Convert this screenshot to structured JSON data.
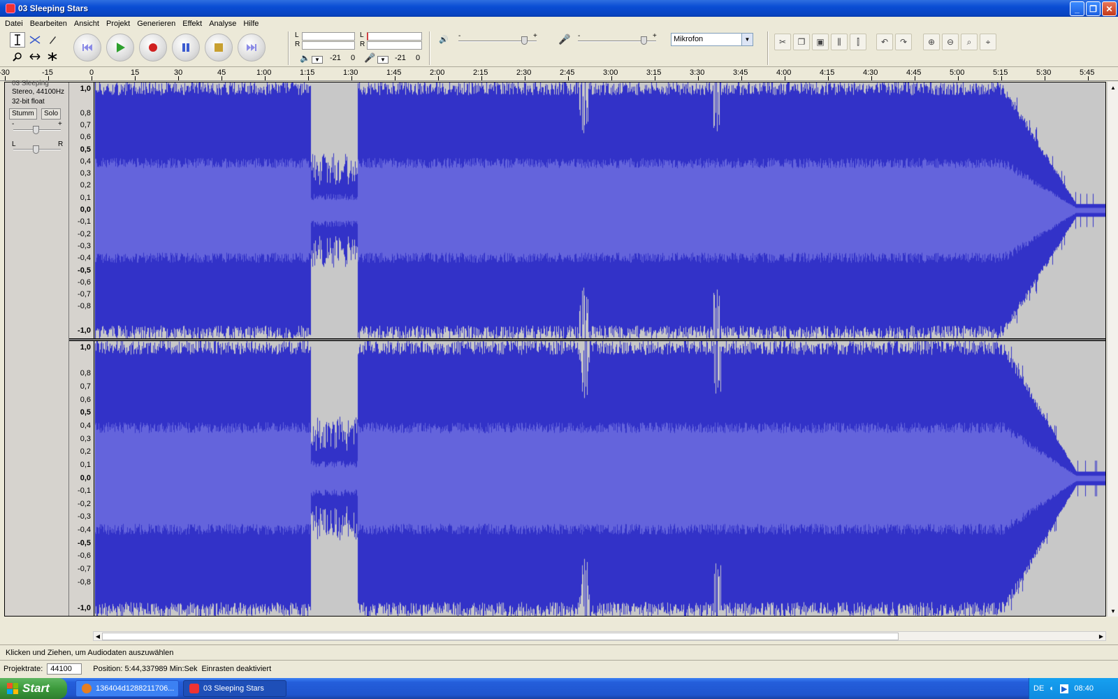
{
  "window": {
    "title": "03 Sleeping Stars",
    "minimize": "_",
    "maximize": "❐",
    "close": "✕"
  },
  "menu": [
    "Datei",
    "Bearbeiten",
    "Ansicht",
    "Projekt",
    "Generieren",
    "Effekt",
    "Analyse",
    "Hilfe"
  ],
  "meters": {
    "play_lr": [
      "L",
      "R"
    ],
    "rec_lr": [
      "L",
      "R"
    ],
    "play_scale": [
      "-21",
      "0"
    ],
    "rec_scale": [
      "-21",
      "0"
    ]
  },
  "mixer": {
    "out_minus": "-",
    "out_plus": "+",
    "in_minus": "-",
    "in_plus": "+",
    "output_volume": 0.9,
    "input_volume": 0.9,
    "input_device": "Mikrofon"
  },
  "ruler": {
    "labels": [
      "-30",
      "-15",
      "0",
      "15",
      "30",
      "45",
      "1:00",
      "1:15",
      "1:30",
      "1:45",
      "2:00",
      "2:15",
      "2:30",
      "2:45",
      "3:00",
      "3:15",
      "3:30",
      "3:45",
      "4:00",
      "4:15",
      "4:30",
      "4:45",
      "5:00",
      "5:15",
      "5:30",
      "5:45"
    ]
  },
  "track": {
    "name": "03 Sleeping",
    "format": "Stereo, 44100Hz",
    "bit_depth": "32-bit float",
    "mute_label": "Stumm",
    "solo_label": "Solo",
    "gain_minus": "-",
    "gain_plus": "+",
    "pan_left": "L",
    "pan_right": "R",
    "channel1_scale": [
      "1,0",
      "0,8",
      "0,7",
      "0,6",
      "0,5",
      "0,4",
      "0,3",
      "0,2",
      "0,1",
      "0,0",
      "-0,1",
      "-0,2",
      "-0,3",
      "-0,4",
      "-0,5",
      "-0,6",
      "-0,7",
      "-0,8",
      "-1,0"
    ],
    "channel2_scale": [
      "1,0",
      "0,8",
      "0,7",
      "0,6",
      "0,5",
      "0,4",
      "0,3",
      "0,2",
      "0,1",
      "0,0",
      "-0,1",
      "-0,2",
      "-0,3",
      "-0,4",
      "-0,5",
      "-0,6",
      "-0,7",
      "-0,8",
      "-1,0"
    ]
  },
  "colors": {
    "wave_peak": "#3232c8",
    "wave_rms": "#6464dc",
    "wave_bg": "#c8c8c8"
  },
  "status": {
    "message": "Klicken und Ziehen, um Audiodaten auszuwählen",
    "rate_label": "Projektrate:",
    "rate_value": "44100",
    "position": "Position: 5:44,337989 Min:Sek",
    "snap": "Einrasten deaktiviert"
  },
  "taskbar": {
    "start": "Start",
    "task1": "136404d1288211706...",
    "task2": "03 Sleeping Stars",
    "lang": "DE",
    "clock": "08:40"
  }
}
